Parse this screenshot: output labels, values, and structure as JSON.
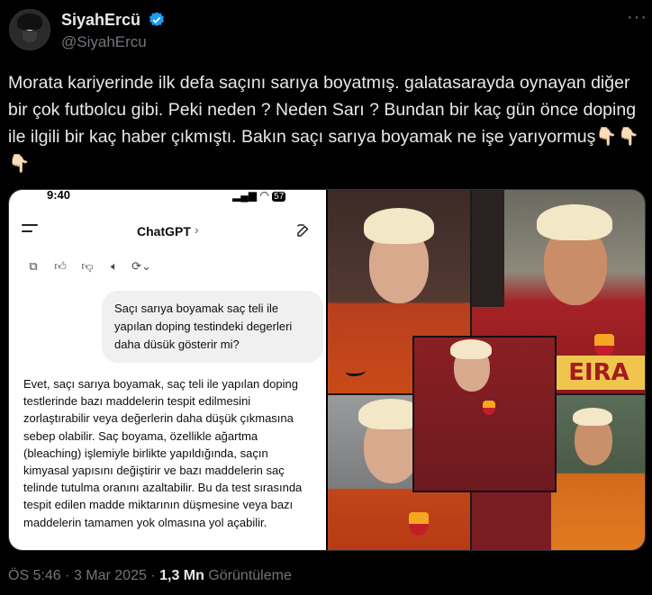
{
  "author": {
    "display_name": "SiyahErcü",
    "handle": "@SiyahErcu",
    "verified": true
  },
  "tweet": {
    "text": "Morata kariyerinde ilk defa saçını sarıya boyatmış. galatasarayda oynayan diğer bir çok futbolcu gibi. Peki neden ? Neden Sarı ? Bundan bir kaç gün önce doping ile ilgili bir kaç haber çıkmıştı. Bakın saçı sarıya boyamak ne işe yarıyormuş👇🏻👇🏻👇🏻"
  },
  "chat_screenshot": {
    "status_time": "9:40",
    "status_battery": "57",
    "title": "ChatGPT",
    "user_message": "Saçı sarıya boyamak saç teli ile yapılan doping testindeki degerleri daha düsük gösterir mi?",
    "assistant_reply": "Evet, saçı sarıya boyamak, saç teli ile yapılan doping testlerinde bazı maddelerin tespit edilmesini zorlaştırabilir veya değerlerin daha düşük çıkmasına sebep olabilir. Saç boyama, özellikle ağartma (bleaching) işlemiyle birlikte yapıldığında, saçın kimyasal yapısını değiştirir ve bazı maddelerin saç telinde tutulma oranını azaltabilir. Bu da test sırasında tespit edilen madde miktarının düşmesine veya bazı maddelerin tamamen yok olmasına yol açabilir."
  },
  "collage": {
    "banner_text": "EIRA"
  },
  "meta": {
    "time": "ÖS 5:46",
    "separator": "·",
    "date": "3 Mar 2025",
    "views_count": "1,3 Mn",
    "views_label": "Görüntüleme"
  },
  "colors": {
    "background": "#000000",
    "text_primary": "#e7e9ea",
    "text_secondary": "#71767b",
    "verified_blue": "#1d9bf0"
  },
  "icons": [
    "more-options-icon",
    "verified-badge-icon",
    "menu-icon",
    "edit-icon",
    "copy-icon",
    "thumbs-up-icon",
    "thumbs-down-icon",
    "speaker-icon",
    "regenerate-icon"
  ]
}
